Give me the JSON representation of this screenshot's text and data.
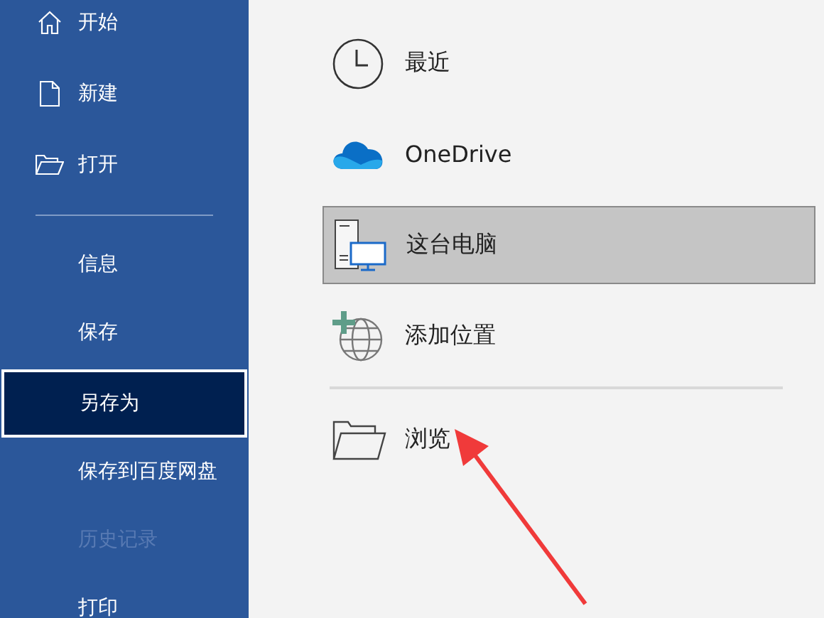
{
  "sidebar": {
    "top_items": [
      {
        "label": "开始",
        "kind": "home",
        "selected": false,
        "disabled": false
      },
      {
        "label": "新建",
        "kind": "new",
        "selected": false,
        "disabled": false
      },
      {
        "label": "打开",
        "kind": "open",
        "selected": false,
        "disabled": false
      }
    ],
    "items": [
      {
        "label": "信息",
        "selected": false,
        "disabled": false
      },
      {
        "label": "保存",
        "selected": false,
        "disabled": false
      },
      {
        "label": "另存为",
        "selected": true,
        "disabled": false
      },
      {
        "label": "保存到百度网盘",
        "selected": false,
        "disabled": false
      },
      {
        "label": "历史记录",
        "selected": false,
        "disabled": true
      },
      {
        "label": "打印",
        "selected": false,
        "disabled": false
      }
    ]
  },
  "locations": [
    {
      "label": "最近",
      "kind": "clock",
      "selected": false
    },
    {
      "label": "OneDrive",
      "kind": "cloud",
      "selected": false
    },
    {
      "label": "这台电脑",
      "kind": "pc",
      "selected": true
    },
    {
      "label": "添加位置",
      "kind": "globe",
      "selected": false
    }
  ],
  "browse": {
    "label": "浏览",
    "kind": "folder",
    "selected": false
  }
}
